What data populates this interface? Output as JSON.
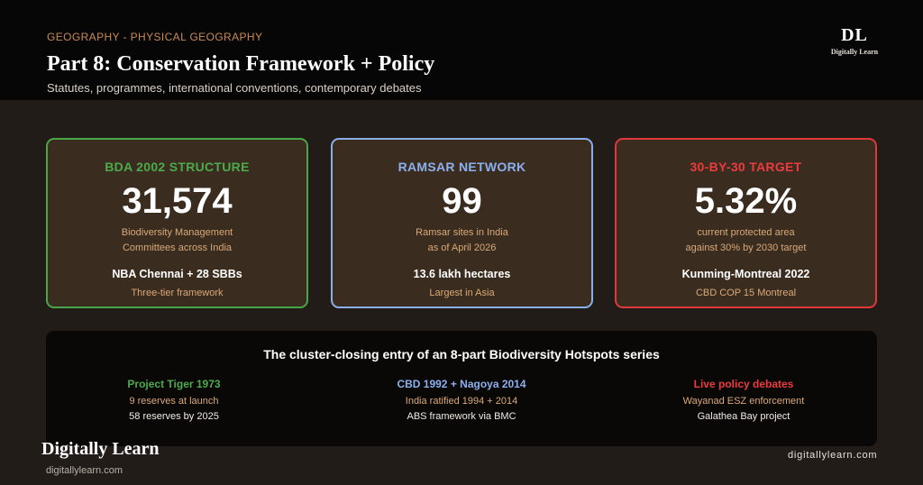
{
  "header": {
    "eyebrow": "GEOGRAPHY - PHYSICAL GEOGRAPHY",
    "title": "Part 8: Conservation Framework + Policy",
    "subtitle": "Statutes, programmes, international conventions, contemporary debates",
    "logo_mark": "DL",
    "logo_sub": "Digitally Learn"
  },
  "cards": [
    {
      "label": "BDA 2002 STRUCTURE",
      "value": "31,574",
      "desc1": "Biodiversity Management",
      "desc2": "Committees across India",
      "strong": "NBA Chennai + 28 SBBs",
      "small": "Three-tier framework"
    },
    {
      "label": "RAMSAR NETWORK",
      "value": "99",
      "desc1": "Ramsar sites in India",
      "desc2": "as of April 2026",
      "strong": "13.6 lakh hectares",
      "small": "Largest in Asia"
    },
    {
      "label": "30-BY-30 TARGET",
      "value": "5.32%",
      "desc1": "current protected area",
      "desc2": "against 30% by 2030 target",
      "strong": "Kunming-Montreal 2022",
      "small": "CBD COP 15 Montreal"
    }
  ],
  "panel": {
    "title": "The cluster-closing entry of an 8-part Biodiversity Hotspots series",
    "columns": [
      {
        "head": "Project Tiger 1973",
        "line1": "9 reserves at launch",
        "line2": "58 reserves by 2025"
      },
      {
        "head": "CBD 1992 + Nagoya 2014",
        "line1": "India ratified 1994 + 2014",
        "line2": "ABS framework via BMC"
      },
      {
        "head": "Live policy debates",
        "line1": "Wayanad ESZ enforcement",
        "line2": "Galathea Bay project"
      }
    ]
  },
  "footer": {
    "brand": "Digitally Learn",
    "brand_url": "digitallylearn.com",
    "url": "digitallylearn.com"
  },
  "colors": {
    "green": "#4bab4b",
    "blue": "#8cb0ee",
    "red": "#ec3b3e",
    "accent": "#c98a52"
  }
}
